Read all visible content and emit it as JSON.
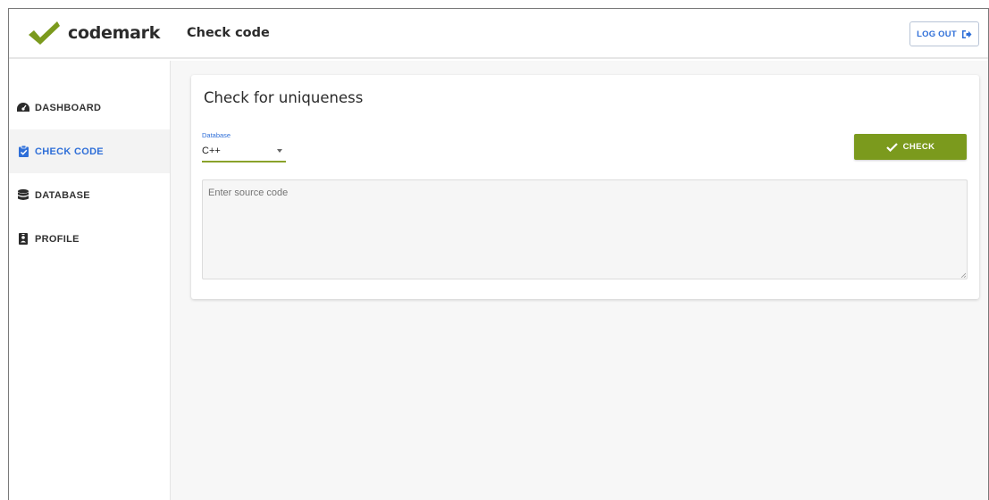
{
  "brand": {
    "name": "codemark",
    "check_color": "#7b9a1d"
  },
  "header": {
    "title": "Check code",
    "logout_label": "LOG OUT",
    "logout_icon": "sign-out-icon"
  },
  "sidebar": {
    "items": [
      {
        "label": "DASHBOARD",
        "icon": "tachometer-icon",
        "active": false
      },
      {
        "label": "CHECK CODE",
        "icon": "clipboard-check-icon",
        "active": true
      },
      {
        "label": "DATABASE",
        "icon": "database-icon",
        "active": false
      },
      {
        "label": "PROFILE",
        "icon": "id-badge-icon",
        "active": false
      }
    ]
  },
  "card": {
    "title": "Check for uniqueness",
    "database_label": "Database",
    "database_value": "C++",
    "check_label": "CHECK",
    "source_placeholder": "Enter source code"
  },
  "colors": {
    "accent": "#2f6fd8",
    "primary_green": "#7b9a1d",
    "underline_green": "#8aa22a"
  }
}
